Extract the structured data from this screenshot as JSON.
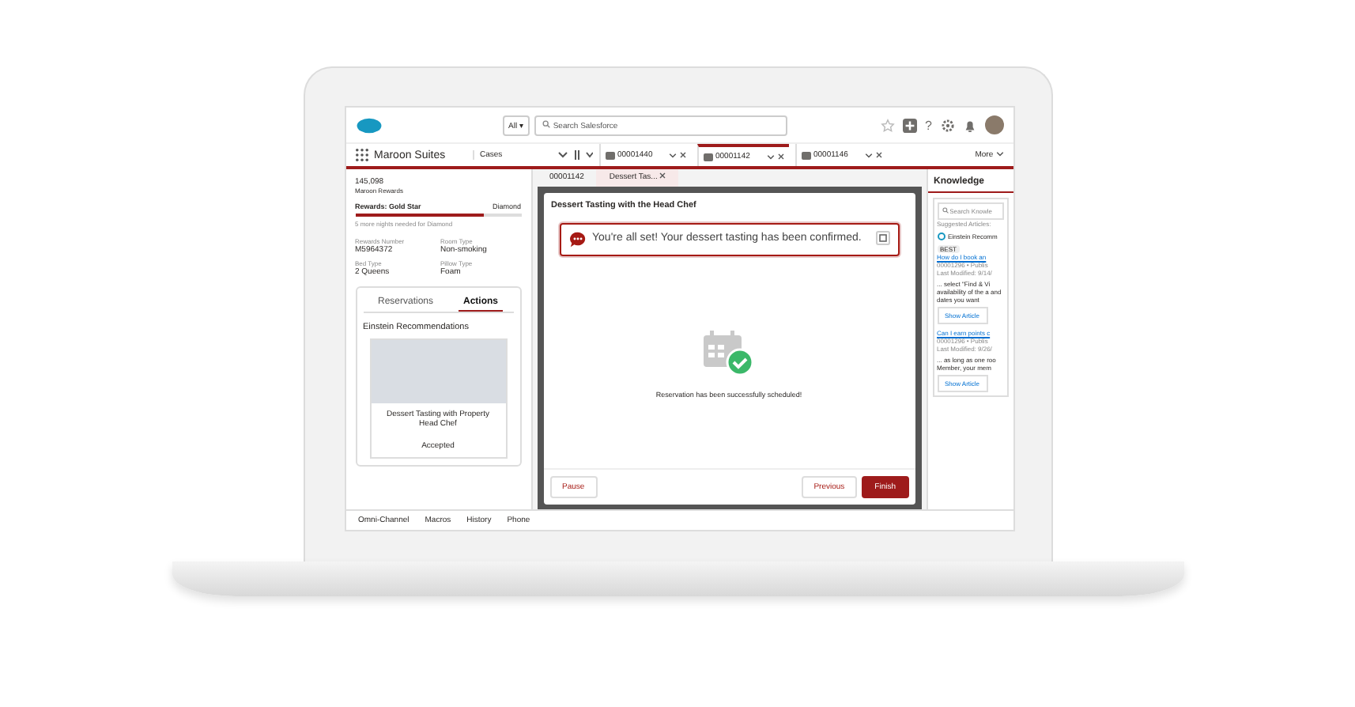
{
  "header": {
    "scope": "All ▾",
    "search_placeholder": "Search Salesforce",
    "help": "?"
  },
  "nav": {
    "app_name": "Maroon Suites",
    "object": "Cases",
    "more": "More",
    "tabs": [
      {
        "label": "00001440",
        "selected": false
      },
      {
        "label": "00001142",
        "selected": true
      },
      {
        "label": "00001146",
        "selected": false
      }
    ]
  },
  "left": {
    "points": "145,098",
    "program": "Maroon Rewards",
    "tier": "Rewards: Gold Star",
    "next_tier": "Diamond",
    "level": 0.78,
    "note": "5 more nights needed for Diamond",
    "fields": [
      {
        "label": "Rewards Number",
        "value": "M5964372"
      },
      {
        "label": "Room Type",
        "value": "Non-smoking"
      },
      {
        "label": "Bed Type",
        "value": "2 Queens"
      },
      {
        "label": "Pillow Type",
        "value": "Foam"
      }
    ],
    "tabs": [
      {
        "label": "Reservations",
        "selected": false
      },
      {
        "label": "Actions",
        "selected": true
      }
    ],
    "section": "Einstein Recommendations",
    "card_title": "Dessert Tasting with Property Head Chef",
    "card_status": "Accepted"
  },
  "center": {
    "subtabs": [
      {
        "label": "00001142",
        "selected": false,
        "closable": false
      },
      {
        "label": "Dessert Tas...",
        "selected": true,
        "closable": true
      }
    ],
    "modal_title": "Dessert Tasting with the Head Chef",
    "alert": "You're all set! Your dessert tasting has been confirmed.",
    "message": "Reservation has been successfully scheduled!",
    "buttons": [
      {
        "label": "Pause",
        "kind": "neutral"
      },
      {
        "label": "Previous",
        "kind": "neutral"
      },
      {
        "label": "Finish",
        "kind": "brand"
      }
    ]
  },
  "right": {
    "title": "Knowledge",
    "search_placeholder": "Search Knowle",
    "suggested": "Suggested Articles:",
    "source": "Einstein Recomm",
    "articles": [
      {
        "badge": "BEST",
        "title": "How do I book an",
        "meta": "00001296 • Publis",
        "modified": "Last Modified: 9/14/",
        "snippet": "... select \"Find & Vi availability of the a and dates you want",
        "action": "Show Article"
      },
      {
        "title": "Can I earn points c",
        "meta": "00001296 • Publis",
        "modified": "Last Modified: 9/26/",
        "snippet": "... as long as one roo Member, your mem",
        "action": "Show Article"
      }
    ]
  },
  "utility": [
    "Omni-Channel",
    "Macros",
    "History",
    "Phone"
  ]
}
